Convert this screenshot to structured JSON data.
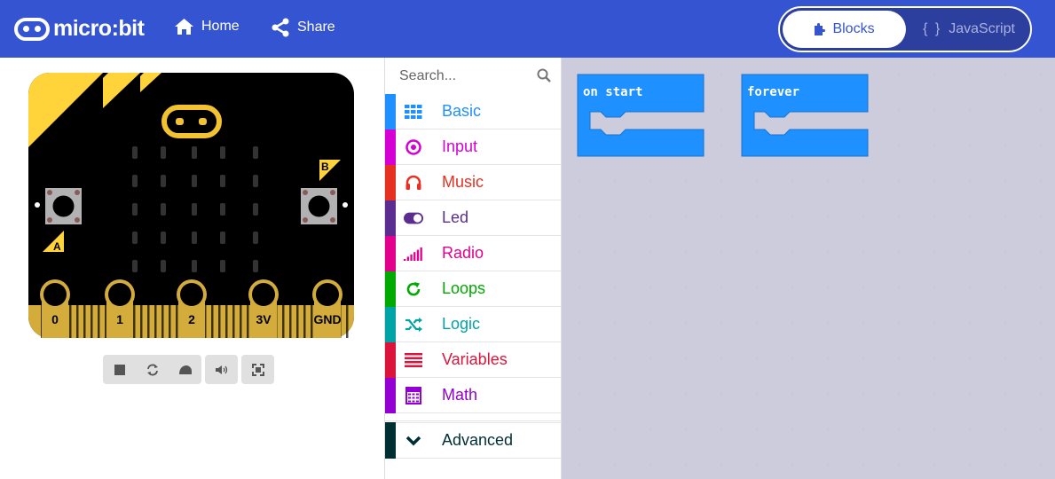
{
  "header": {
    "logo_text": "micro:bit",
    "nav": [
      {
        "label": "Home",
        "icon": "home-icon"
      },
      {
        "label": "Share",
        "icon": "share-icon"
      }
    ],
    "editor_toggle": {
      "blocks_label": "Blocks",
      "javascript_label": "JavaScript",
      "js_icon_glyph": "{ }",
      "active": "Blocks"
    },
    "colors": {
      "bar": "#3454d1",
      "active_text": "#3454d1"
    }
  },
  "simulator": {
    "button_a_label": "A",
    "button_b_label": "B",
    "pins": [
      "0",
      "1",
      "2",
      "3V",
      "GND"
    ],
    "led_matrix": "5x5 unlit",
    "controls": [
      {
        "name": "stop-icon"
      },
      {
        "name": "restart-icon"
      },
      {
        "name": "slow-motion-icon"
      },
      {
        "name": "mute-icon"
      },
      {
        "name": "fullscreen-icon"
      }
    ]
  },
  "toolbox": {
    "search_placeholder": "Search...",
    "categories": [
      {
        "label": "Basic",
        "color": "#1e90ff",
        "icon": "grid-icon"
      },
      {
        "label": "Input",
        "color": "#d400d4",
        "icon": "target-icon"
      },
      {
        "label": "Music",
        "color": "#e63022",
        "icon": "headphones-icon"
      },
      {
        "label": "Led",
        "color": "#5c2d91",
        "icon": "toggle-icon"
      },
      {
        "label": "Radio",
        "color": "#e3008c",
        "icon": "signal-bars-icon"
      },
      {
        "label": "Loops",
        "color": "#00aa00",
        "icon": "refresh-icon"
      },
      {
        "label": "Logic",
        "color": "#00a4a6",
        "icon": "shuffle-icon"
      },
      {
        "label": "Variables",
        "color": "#dc143c",
        "icon": "list-icon"
      },
      {
        "label": "Math",
        "color": "#9400d3",
        "icon": "calculator-icon"
      }
    ],
    "advanced": {
      "label": "Advanced",
      "color": "#002f33",
      "icon": "chevron-down-icon"
    }
  },
  "workspace": {
    "blocks": [
      {
        "label": "on start"
      },
      {
        "label": "forever"
      }
    ],
    "block_color": "#1e90ff",
    "background": "#ecf0f1"
  }
}
